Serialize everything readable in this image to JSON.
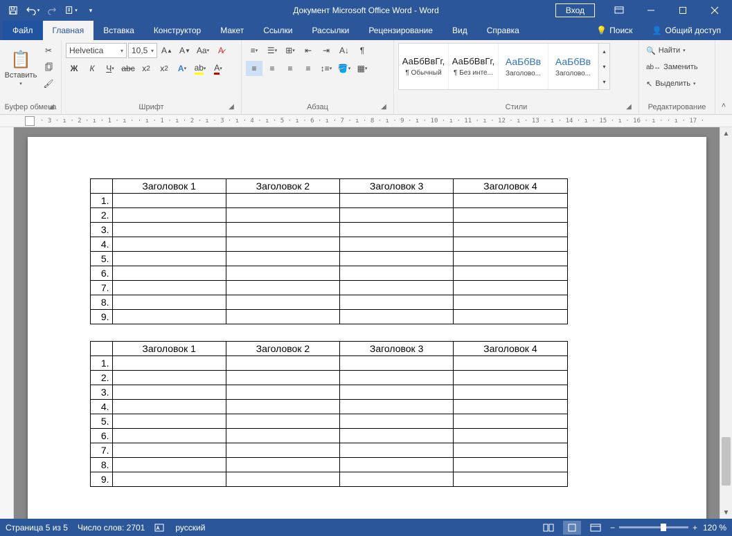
{
  "title": "Документ Microsoft Office Word  -  Word",
  "signin": "Вход",
  "tabs": {
    "file": "Файл",
    "home": "Главная",
    "insert": "Вставка",
    "design": "Конструктор",
    "layout": "Макет",
    "references": "Ссылки",
    "mailings": "Рассылки",
    "review": "Рецензирование",
    "view": "Вид",
    "help": "Справка",
    "search": "Поиск",
    "share": "Общий доступ"
  },
  "clipboard": {
    "paste": "Вставить",
    "label": "Буфер обмена"
  },
  "font": {
    "name": "Helvetica",
    "size": "10,5",
    "label": "Шрифт",
    "bold": "Ж",
    "italic": "К",
    "underline": "Ч"
  },
  "paragraph": {
    "label": "Абзац"
  },
  "styles": {
    "label": "Стили",
    "preview": "АаБбВвГг,",
    "preview_h": "АаБбВв",
    "items": [
      "¶ Обычный",
      "¶ Без инте...",
      "Заголово...",
      "Заголово..."
    ]
  },
  "editing": {
    "label": "Редактирование",
    "find": "Найти",
    "replace": "Заменить",
    "select": "Выделить"
  },
  "ruler": "· 3 · ı · 2 · ı · 1 · ı ·   · ı · 1 · ı · 2 · ı · 3 · ı · 4 · ı · 5 · ı · 6 · ı · 7 · ı · 8 · ı · 9 · ı · 10 · ı · 11 · ı · 12 · ı · 13 · ı · 14 · ı · 15 · ı · 16 · ı ·   · ı · 17 ·",
  "table": {
    "headers": [
      "Заголовок 1",
      "Заголовок 2",
      "Заголовок 3",
      "Заголовок 4"
    ],
    "rows": [
      "1.",
      "2.",
      "3.",
      "4.",
      "5.",
      "6.",
      "7.",
      "8.",
      "9."
    ]
  },
  "status": {
    "page": "Страница 5 из 5",
    "words": "Число слов: 2701",
    "lang": "русский",
    "zoom": "120 %"
  }
}
